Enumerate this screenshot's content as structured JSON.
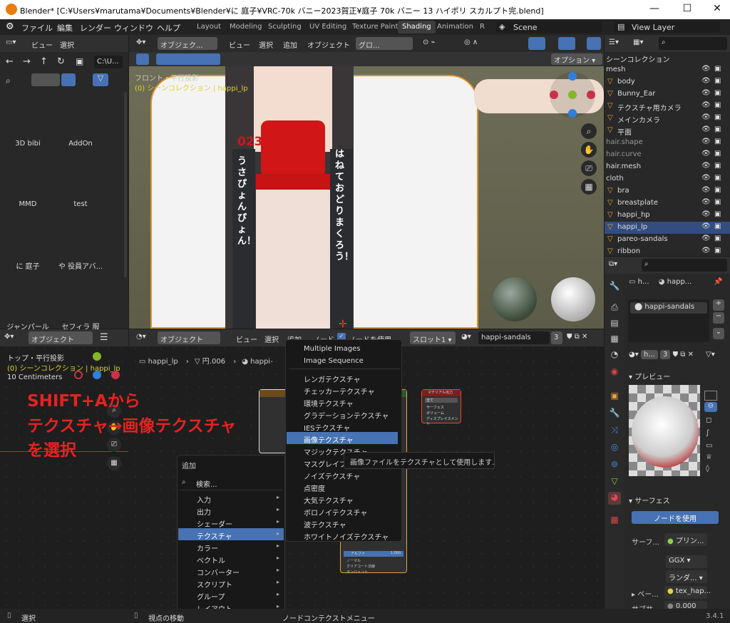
{
  "window": {
    "title": "Blender* [C:¥Users¥marutama¥Documents¥Blender¥に 庭子¥VRC-70k バニー2023賀正¥庭子 70k バニー 13 ハイポリ スカルプト完.blend]"
  },
  "menu": [
    "ファイル",
    "編集",
    "レンダー",
    "ウィンドウ",
    "ヘルプ"
  ],
  "workspaces": [
    "Layout",
    "Modeling",
    "Sculpting",
    "UV Editing",
    "Texture Paint",
    "Shading",
    "Animation",
    "R"
  ],
  "scene": "Scene",
  "view_layer": "View Layer",
  "filebrowser": {
    "header": [
      "ビュー",
      "選択"
    ],
    "path": "C:\\U...",
    "folders": [
      "3D bibi",
      "AddOn",
      "MMD",
      "test",
      "に 庭子",
      "や 役員アバ...",
      "ジャンパール",
      "セフィラ 服"
    ]
  },
  "viewport": {
    "mode": "オブジェク...",
    "menus": [
      "ビュー",
      "選択",
      "追加",
      "オブジェクト"
    ],
    "shading": "グロ...",
    "options": "オプション",
    "view_name": "フロント・平行投影",
    "collection": "(0) シーンコレクション | happi_lp"
  },
  "outliner": {
    "root": "シーンコレクション",
    "rows": [
      "mesh",
      "body",
      "Bunny_Ear",
      "テクスチャ用カメラ",
      "メインカメラ",
      "平面",
      "hair.shape",
      "hair.curve",
      "hair.mesh",
      "cloth",
      "bra",
      "breastplate",
      "happi_hp",
      "happi_lp",
      "pareo-sandals",
      "ribbon"
    ]
  },
  "props": {
    "obj": "h...",
    "mat": "happ...",
    "slot": "happi-sandals",
    "matfield": "h...",
    "users": "3",
    "preview": "プレビュー",
    "surface": "サーフェス",
    "use_nodes": "ノードを使用",
    "surface_label": "サーフ...",
    "principled": "プリン...",
    "ggx": "GGX",
    "random": "ランダ...",
    "base": "ベー...",
    "tex": "tex_hap...",
    "subsurf": "サブサ...",
    "subsurf_val": "0.000"
  },
  "bl_view": {
    "mode": "オブジェクト",
    "title": "トップ・平行投影",
    "collection": "(0) シーンコレクション | happi_lp",
    "scale": "10 Centimeters"
  },
  "node_editor": {
    "mode": "オブジェクト",
    "menus": [
      "ビュー",
      "選択",
      "追加",
      "ノード"
    ],
    "use_nodes": "ノードを使用",
    "slot": "スロット1",
    "material": "happi-sandals",
    "users": "3",
    "breadcrumb": [
      "happi_lp",
      "円.006",
      "happi-"
    ],
    "out_title": "マテリアル出力",
    "out_all": "全て",
    "out_sockets": [
      "サーフェス",
      "ボリューム",
      "ディスプレイスメント"
    ],
    "bsdf_rows": [
      "アルファ",
      "ノーマル",
      "クリアコート法線",
      "タンジェント"
    ],
    "bsdf_val": "1.000"
  },
  "add_menu": {
    "title": "追加",
    "search": "検索...",
    "items": [
      "入力",
      "出力",
      "シェーダー",
      "テクスチャ",
      "カラー",
      "ベクトル",
      "コンバーター",
      "スクリプト",
      "グループ",
      "レイアウト"
    ]
  },
  "tex_menu": {
    "items": [
      "Multiple Images",
      "Image Sequence",
      "レンガテクスチャ",
      "チェッカーテクスチャ",
      "環境テクスチャ",
      "グラデーションテクスチャ",
      "IESテクスチャ",
      "画像テクスチャ",
      "マジックテクスチャ",
      "マスグレイブ",
      "ノイズテクスチャ",
      "点密度",
      "大気テクスチャ",
      "ボロノイテクスチャ",
      "波テクスチャ",
      "ホワイトノイズテクスチャ"
    ]
  },
  "tooltip": "画像ファイルをテクスチャとして使用します.",
  "annotation": [
    "SHIFT+Aから",
    "テクスチャ→画像テクスチャ",
    "を選択"
  ],
  "status": {
    "left": "選択",
    "mid": "視点の移動",
    "node": "ノードコンテクストメニュー",
    "version": "3.4.1"
  },
  "shirt": {
    "left_text": "うさぴょんぴょん！",
    "right_text": "はねておどりまくろう！",
    "num": "023"
  }
}
